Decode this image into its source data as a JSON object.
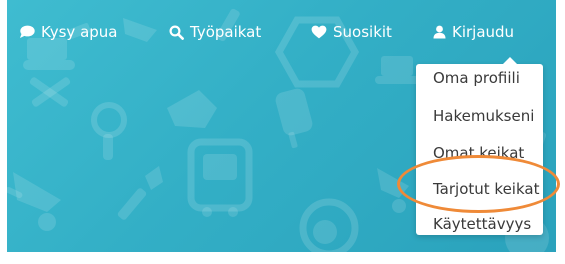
{
  "nav": {
    "ask_label": "Kysy apua",
    "jobs_label": "Työpaikat",
    "favorites_label": "Suosikit",
    "login_label": "Kirjaudu"
  },
  "user_menu": {
    "items": [
      {
        "label": "Oma profiili"
      },
      {
        "label": "Hakemukseni"
      },
      {
        "label": "Omat keikat"
      },
      {
        "label": "Tarjotut keikat"
      },
      {
        "label": "Käytettävyys"
      }
    ],
    "highlighted_index": 3
  },
  "colors": {
    "hero_background": "#34b0c7",
    "nav_text": "#ffffff",
    "menu_background": "#ffffff",
    "menu_text": "#3a3a3a",
    "highlight_ring": "#ef8a38",
    "pattern_icons": "#ffffff"
  },
  "icons": {
    "ask": "speech-bubble-icon",
    "jobs": "search-icon",
    "favorites": "heart-icon",
    "login": "user-icon"
  }
}
